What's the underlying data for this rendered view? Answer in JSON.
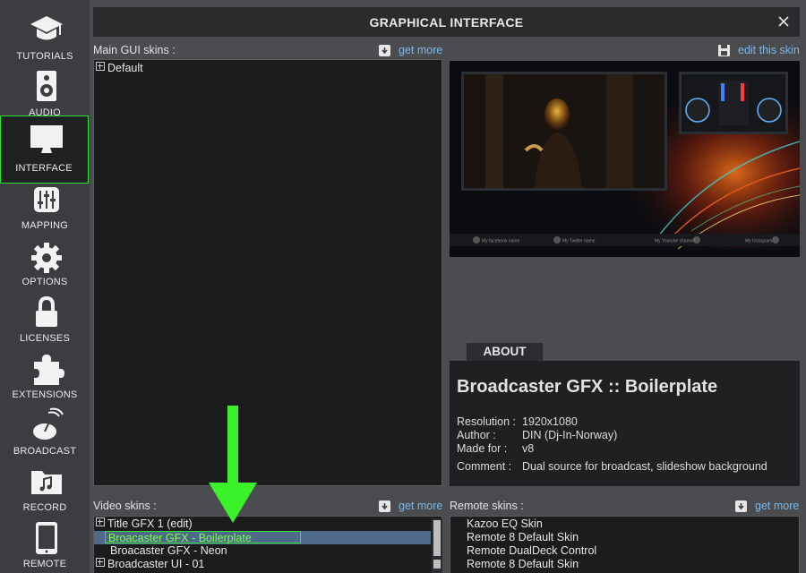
{
  "nav": {
    "items": [
      {
        "label": "TUTORIALS",
        "icon": "graduation-cap-icon"
      },
      {
        "label": "AUDIO",
        "icon": "speaker-icon"
      },
      {
        "label": "INTERFACE",
        "icon": "monitor-icon"
      },
      {
        "label": "MAPPING",
        "icon": "sliders-icon"
      },
      {
        "label": "OPTIONS",
        "icon": "gear-icon"
      },
      {
        "label": "LICENSES",
        "icon": "lock-icon"
      },
      {
        "label": "EXTENSIONS",
        "icon": "puzzle-icon"
      },
      {
        "label": "BROADCAST",
        "icon": "broadcast-icon"
      },
      {
        "label": "RECORD",
        "icon": "music-folder-icon"
      },
      {
        "label": "REMOTE",
        "icon": "tablet-icon"
      }
    ],
    "active": "INTERFACE"
  },
  "header": {
    "title": "GRAPHICAL INTERFACE",
    "close": "×"
  },
  "main_gui": {
    "label": "Main GUI skins :",
    "get_more": "get more",
    "edit": "edit this skin",
    "items": [
      "Default"
    ]
  },
  "video": {
    "label": "Video skins :",
    "get_more": "get more",
    "items": [
      {
        "text": "Title GFX 1 (edit)",
        "expand": true
      },
      {
        "text": "Broacaster GFX - Boilerplate",
        "selected": true
      },
      {
        "text": "Broacaster GFX - Neon"
      },
      {
        "text": "Broadcaster UI - 01",
        "expand": true
      }
    ]
  },
  "remote": {
    "label": "Remote skins :",
    "get_more": "get more",
    "items": [
      "Kazoo EQ Skin",
      "Remote 8 Default Skin",
      "Remote DualDeck Control",
      "Remote 8 Default Skin"
    ]
  },
  "preview": {
    "footer": [
      "My facebook name",
      "My Twitter name",
      "My Youtube channel",
      "My Instagram"
    ]
  },
  "about": {
    "tab": "ABOUT",
    "title": "Broadcaster GFX :: Boilerplate",
    "resolution": {
      "k": "Resolution :",
      "v": "1920x1080"
    },
    "author": {
      "k": "Author :",
      "v": "DIN (Dj-In-Norway)"
    },
    "made_for": {
      "k": "Made for :",
      "v": "v8"
    },
    "comment": {
      "k": "Comment :",
      "v": "Dual source for broadcast, slideshow background"
    }
  },
  "colors": {
    "accent": "#36e13a",
    "link": "#7fb7e8",
    "selected_row": "#4e6a88"
  }
}
